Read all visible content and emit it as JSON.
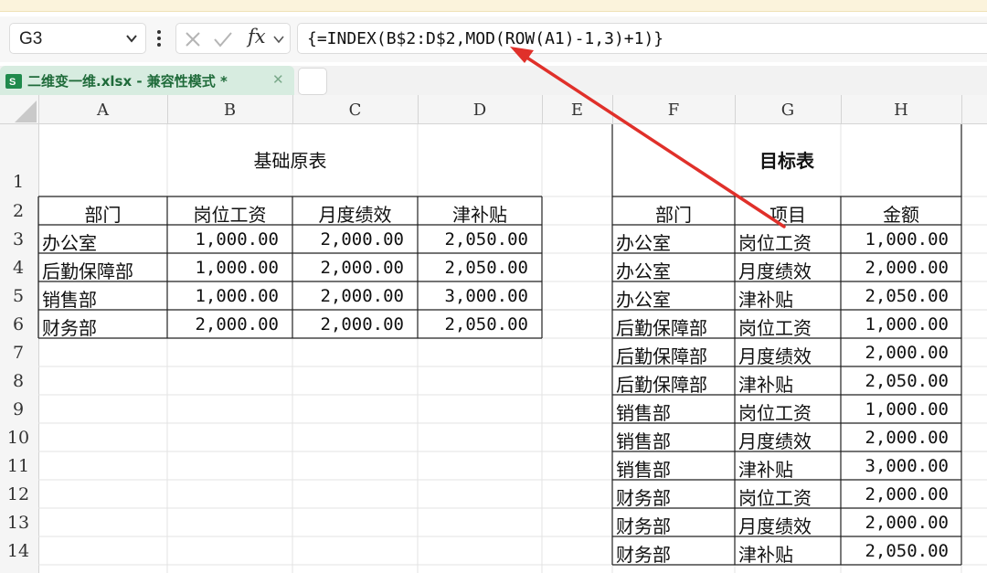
{
  "formula_bar": {
    "name_box": "G3",
    "fx_label": "fx",
    "formula": "{=INDEX(B$2:D$2,MOD(ROW(A1)-1,3)+1)}"
  },
  "tabs": [
    {
      "label": "二维变一维.xlsx  -  兼容性模式 *",
      "active": true
    }
  ],
  "columns": [
    "A",
    "B",
    "C",
    "D",
    "E",
    "F",
    "G",
    "H"
  ],
  "rows": [
    "1",
    "2",
    "3",
    "4",
    "5",
    "6",
    "7",
    "8",
    "9",
    "10",
    "11",
    "12",
    "13",
    "14"
  ],
  "source_table": {
    "title": "基础原表",
    "headers": [
      "部门",
      "岗位工资",
      "月度绩效",
      "津补贴"
    ],
    "rows": [
      [
        "办公室",
        "1,000.00",
        "2,000.00",
        "2,050.00"
      ],
      [
        "后勤保障部",
        "1,000.00",
        "2,000.00",
        "2,050.00"
      ],
      [
        "销售部",
        "1,000.00",
        "2,000.00",
        "3,000.00"
      ],
      [
        "财务部",
        "2,000.00",
        "2,000.00",
        "2,050.00"
      ]
    ]
  },
  "target_table": {
    "title": "目标表",
    "headers": [
      "部门",
      "项目",
      "金额"
    ],
    "rows": [
      [
        "办公室",
        "岗位工资",
        "1,000.00"
      ],
      [
        "办公室",
        "月度绩效",
        "2,000.00"
      ],
      [
        "办公室",
        "津补贴",
        "2,050.00"
      ],
      [
        "后勤保障部",
        "岗位工资",
        "1,000.00"
      ],
      [
        "后勤保障部",
        "月度绩效",
        "2,000.00"
      ],
      [
        "后勤保障部",
        "津补贴",
        "2,050.00"
      ],
      [
        "销售部",
        "岗位工资",
        "1,000.00"
      ],
      [
        "销售部",
        "月度绩效",
        "2,000.00"
      ],
      [
        "销售部",
        "津补贴",
        "3,000.00"
      ],
      [
        "财务部",
        "岗位工资",
        "2,000.00"
      ],
      [
        "财务部",
        "月度绩效",
        "2,000.00"
      ],
      [
        "财务部",
        "津补贴",
        "2,050.00"
      ]
    ]
  },
  "colors": {
    "arrow": "#e0302a",
    "tab_bg": "#d7ece0",
    "tab_text": "#1f6b3a",
    "excel_icon": "#1f8a4c"
  }
}
